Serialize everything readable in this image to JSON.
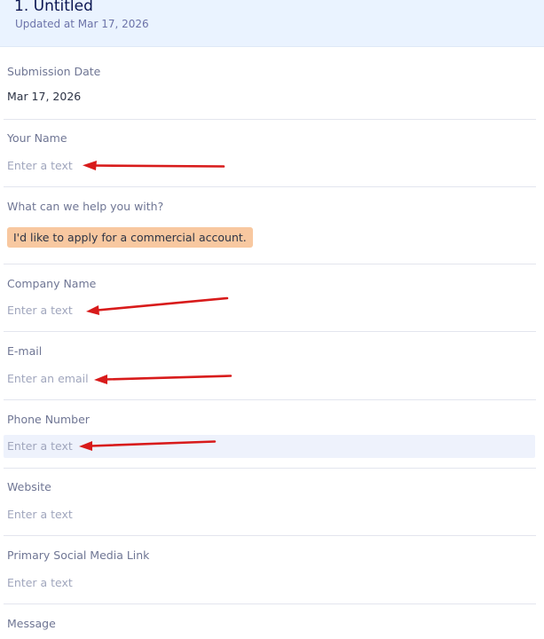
{
  "header": {
    "title": "1. Untitled",
    "updated": "Updated at Mar 17, 2026"
  },
  "fields": [
    {
      "label": "Submission Date",
      "value": "Mar 17, 2026"
    },
    {
      "label": "Your Name",
      "placeholder": "Enter a text"
    },
    {
      "label": "What can we help you with?",
      "selected": "I'd like to apply for a commercial account."
    },
    {
      "label": "Company Name",
      "placeholder": "Enter a text"
    },
    {
      "label": "E-mail",
      "placeholder": "Enter an email"
    },
    {
      "label": "Phone Number",
      "placeholder": "Enter a text"
    },
    {
      "label": "Website",
      "placeholder": "Enter a text"
    },
    {
      "label": "Primary Social Media Link",
      "placeholder": "Enter a text"
    },
    {
      "label": "Message"
    }
  ],
  "colors": {
    "annotation_arrow": "#d81b1b",
    "chip_background": "#f8c8a0",
    "header_background": "#eaf3ff"
  }
}
